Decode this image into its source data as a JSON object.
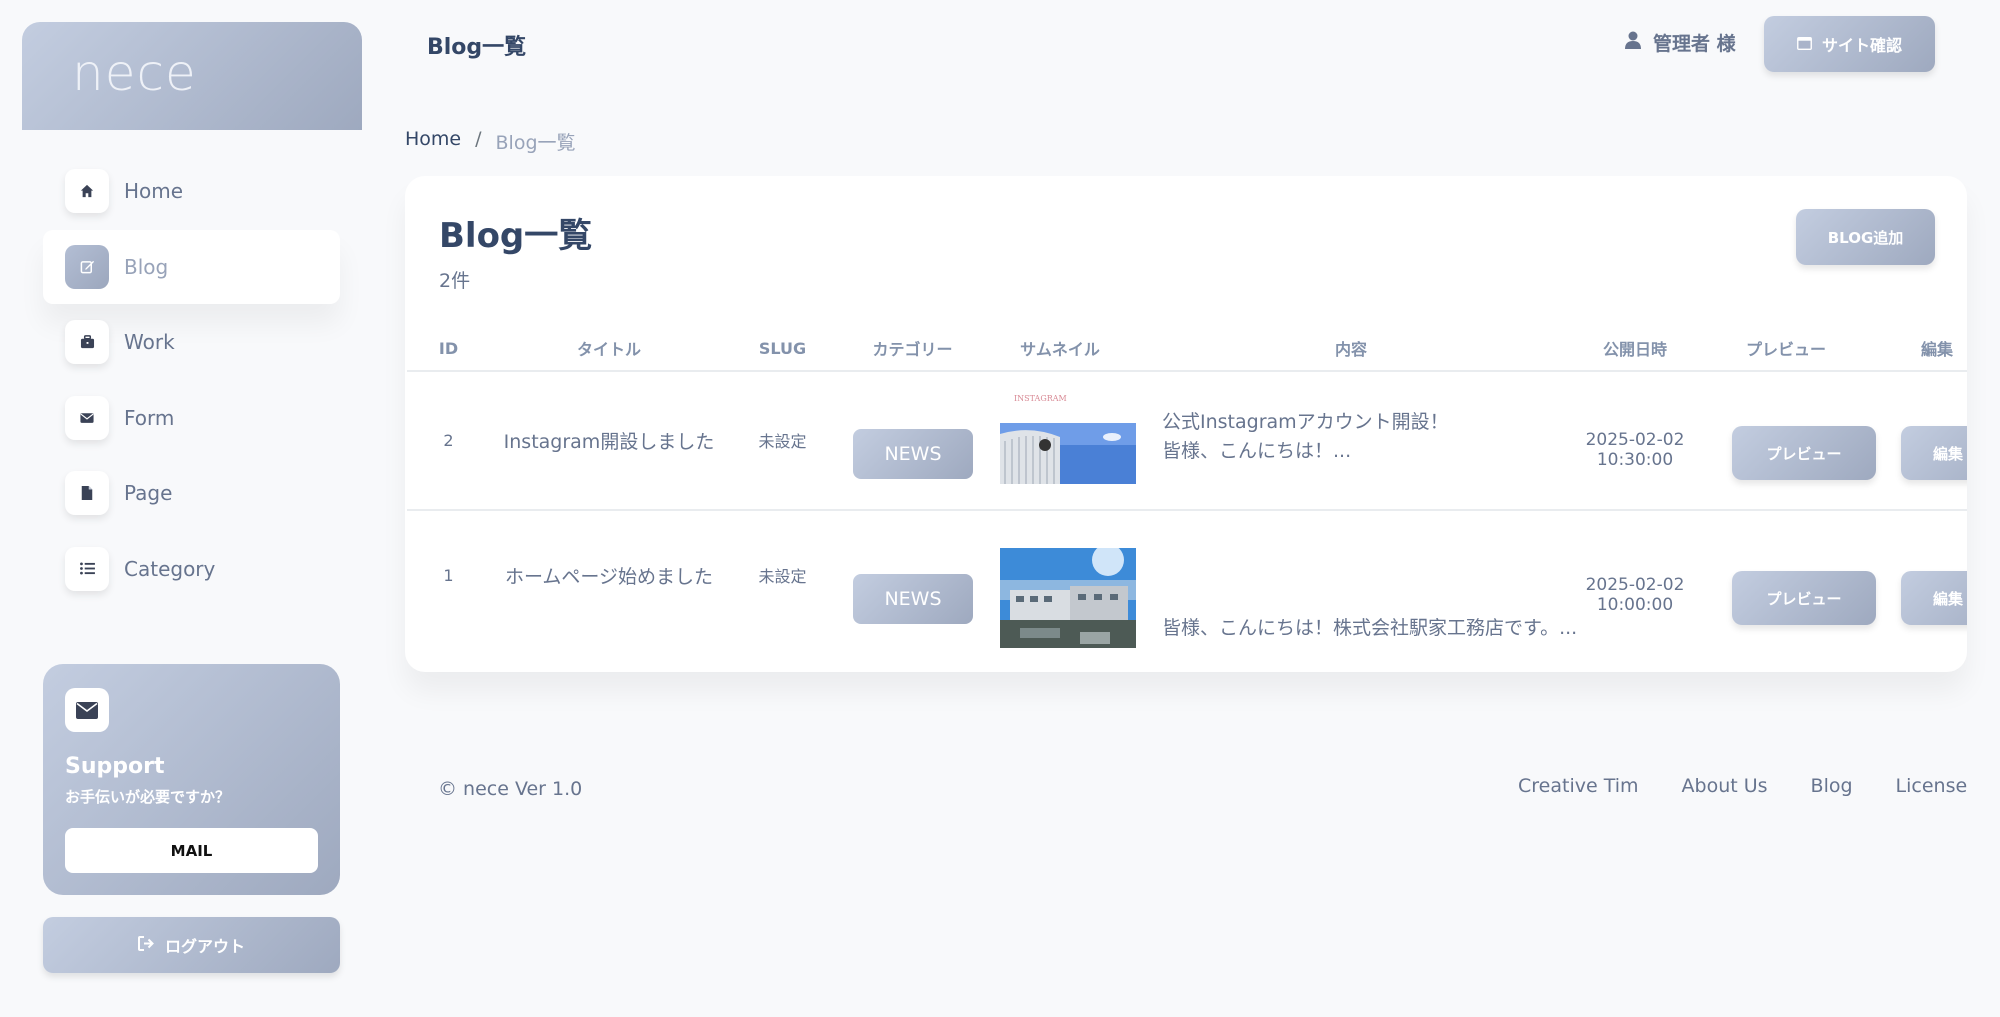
{
  "brand": {
    "name": "nece"
  },
  "sidebar": {
    "items": [
      {
        "label": "Home",
        "icon": "home-icon"
      },
      {
        "label": "Blog",
        "icon": "edit-icon",
        "active": true
      },
      {
        "label": "Work",
        "icon": "briefcase-icon"
      },
      {
        "label": "Form",
        "icon": "envelope-icon"
      },
      {
        "label": "Page",
        "icon": "file-icon"
      },
      {
        "label": "Category",
        "icon": "list-icon"
      }
    ]
  },
  "support": {
    "title": "Support",
    "subtitle": "お手伝いが必要ですか？",
    "button": "MAIL"
  },
  "logout": {
    "label": "ログアウト"
  },
  "topbar": {
    "title": "Blog一覧",
    "user": "管理者 様",
    "site_button": "サイト確認"
  },
  "breadcrumb": {
    "home": "Home",
    "separator": "/",
    "current": "Blog一覧"
  },
  "card": {
    "title": "Blog一覧",
    "count": "2件",
    "add_button": "BLOG追加",
    "columns": [
      "ID",
      "タイトル",
      "SLUG",
      "カテゴリー",
      "サムネイル",
      "内容",
      "公開日時",
      "プレビュー",
      "編集"
    ],
    "rows": [
      {
        "id": "2",
        "title": "Instagram開設しました",
        "slug": "未設定",
        "category": "NEWS",
        "content_line1": "公式Instagramアカウント開設！",
        "content_line2": "皆様、こんにちは！...",
        "date": "2025-02-02",
        "time": "10:30:00",
        "preview": "プレビュー",
        "edit": "編集",
        "thumb_text": "INSTAGRAM"
      },
      {
        "id": "1",
        "title": "ホームページ始めました",
        "slug": "未設定",
        "category": "NEWS",
        "content_line1": "",
        "content_line2": "皆様、こんにちは！株式会社駅家工務店です。...",
        "date": "2025-02-02",
        "time": "10:00:00",
        "preview": "プレビュー",
        "edit": "編集"
      }
    ]
  },
  "footer": {
    "copyright": "© nece Ver 1.0",
    "links": [
      "Creative Tim",
      "About Us",
      "Blog",
      "License"
    ]
  },
  "colors": {
    "accent_gradient_start": "#c3cde0",
    "accent_gradient_end": "#9ea9bf",
    "text_dark": "#344767",
    "text_muted": "#67748e"
  }
}
